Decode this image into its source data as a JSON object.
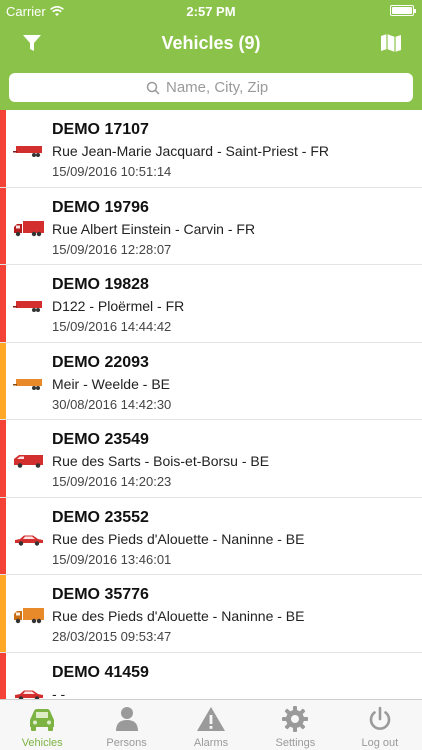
{
  "status_bar": {
    "carrier": "Carrier",
    "time": "2:57 PM"
  },
  "nav": {
    "title": "Vehicles (9)",
    "filter_icon": "filter-icon",
    "map_icon": "map-icon"
  },
  "search": {
    "placeholder": "Name, City, Zip",
    "value": ""
  },
  "colors": {
    "brand_green": "#8bc34a",
    "status_red": "#f44336",
    "status_orange": "#ffa726",
    "vehicle_red": "#d32f2f",
    "vehicle_orange": "#e88a2a"
  },
  "vehicles": [
    {
      "name": "DEMO 17107",
      "address": "Rue Jean-Marie Jacquard - Saint-Priest - FR",
      "date": "15/09/2016 10:51:14",
      "status": "red",
      "icon": "trailer-icon"
    },
    {
      "name": "DEMO 19796",
      "address": "Rue Albert Einstein - Carvin - FR",
      "date": "15/09/2016 12:28:07",
      "status": "red",
      "icon": "truck-icon"
    },
    {
      "name": "DEMO 19828",
      "address": "D122 - Ploërmel - FR",
      "date": "15/09/2016 14:44:42",
      "status": "red",
      "icon": "trailer-icon"
    },
    {
      "name": "DEMO 22093",
      "address": "Meir - Weelde - BE",
      "date": "30/08/2016 14:42:30",
      "status": "orange",
      "icon": "trailer-icon"
    },
    {
      "name": "DEMO 23549",
      "address": "Rue des Sarts - Bois-et-Borsu - BE",
      "date": "15/09/2016 14:20:23",
      "status": "red",
      "icon": "van-icon"
    },
    {
      "name": "DEMO 23552",
      "address": "Rue des Pieds d'Alouette - Naninne - BE",
      "date": "15/09/2016 13:46:01",
      "status": "red",
      "icon": "car-icon"
    },
    {
      "name": "DEMO 35776",
      "address": "Rue des Pieds d'Alouette - Naninne - BE",
      "date": "28/03/2015 09:53:47",
      "status": "orange",
      "icon": "truck-icon"
    },
    {
      "name": "DEMO 41459",
      "address": "- -",
      "date": "",
      "status": "red",
      "icon": "car-icon"
    }
  ],
  "tabs": [
    {
      "label": "Vehicles",
      "icon": "car-icon",
      "active": true
    },
    {
      "label": "Persons",
      "icon": "person-icon",
      "active": false
    },
    {
      "label": "Alarms",
      "icon": "warning-icon",
      "active": false
    },
    {
      "label": "Settings",
      "icon": "gear-icon",
      "active": false
    },
    {
      "label": "Log out",
      "icon": "power-icon",
      "active": false
    }
  ]
}
